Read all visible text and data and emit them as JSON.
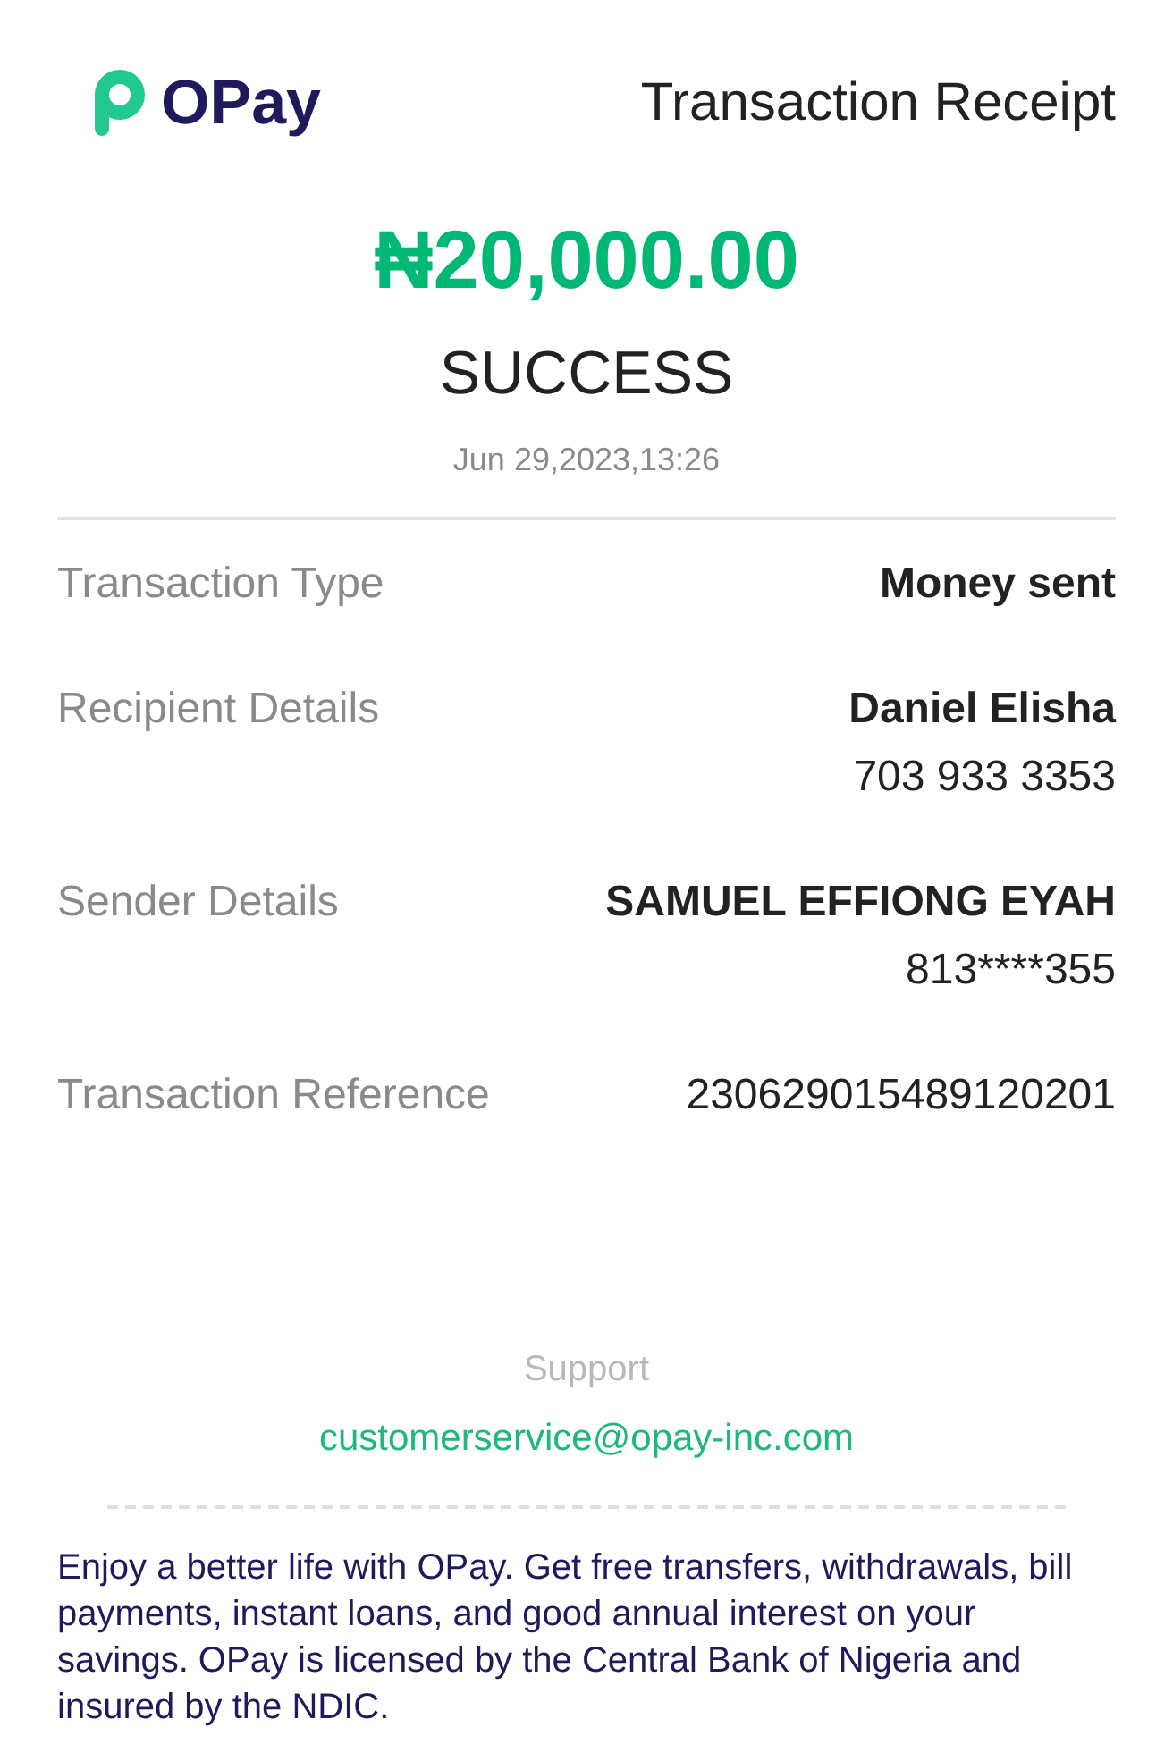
{
  "header": {
    "brand": "OPay",
    "title": "Transaction Receipt"
  },
  "amount": "₦20,000.00",
  "status": "SUCCESS",
  "date": "Jun 29,2023,13:26",
  "details": [
    {
      "label": "Transaction Type",
      "values": [
        {
          "text": "Money sent",
          "bold": true
        }
      ]
    },
    {
      "label": "Recipient Details",
      "values": [
        {
          "text": "Daniel Elisha",
          "bold": true
        },
        {
          "text": "703 933 3353",
          "bold": false
        }
      ]
    },
    {
      "label": "Sender Details",
      "values": [
        {
          "text": "SAMUEL EFFIONG EYAH",
          "bold": true
        },
        {
          "text": "813****355",
          "bold": false
        }
      ]
    },
    {
      "label": "Transaction Reference",
      "values": [
        {
          "text": "230629015489120201",
          "bold": false
        }
      ]
    }
  ],
  "support": {
    "label": "Support",
    "email": "customerservice@opay-inc.com"
  },
  "footer": "Enjoy a better life with OPay. Get free transfers, withdrawals, bill payments, instant loans, and good annual interest on your savings. OPay is licensed by the Central Bank of Nigeria and insured by the NDIC."
}
